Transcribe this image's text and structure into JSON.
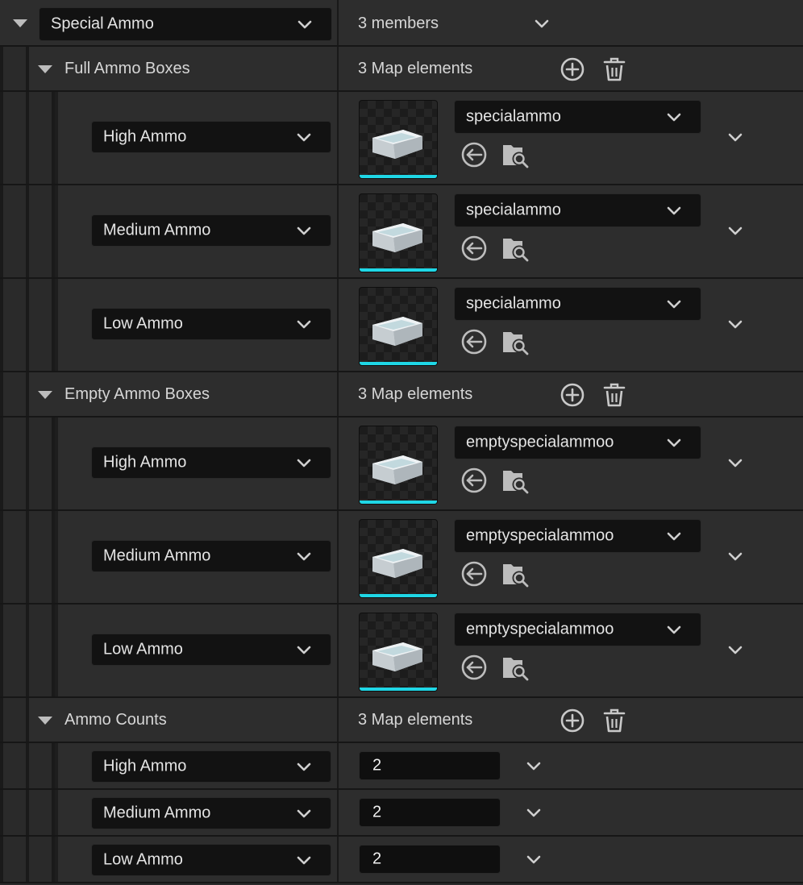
{
  "accent_color": "#1fd7e6",
  "top": {
    "category_value": "Special Ammo",
    "summary": "3 members"
  },
  "maps": [
    {
      "title": "Full Ammo Boxes",
      "count_label": "3 Map elements",
      "entries": [
        {
          "key": "High Ammo",
          "asset": "specialammo"
        },
        {
          "key": "Medium Ammo",
          "asset": "specialammo"
        },
        {
          "key": "Low Ammo",
          "asset": "specialammo"
        }
      ]
    },
    {
      "title": "Empty Ammo Boxes",
      "count_label": "3 Map elements",
      "entries": [
        {
          "key": "High Ammo",
          "asset": "emptyspecialammoo"
        },
        {
          "key": "Medium Ammo",
          "asset": "emptyspecialammoo"
        },
        {
          "key": "Low Ammo",
          "asset": "emptyspecialammoo"
        }
      ]
    },
    {
      "title": "Ammo Counts",
      "count_label": "3 Map elements",
      "entries": [
        {
          "key": "High Ammo",
          "value": "2"
        },
        {
          "key": "Medium Ammo",
          "value": "2"
        },
        {
          "key": "Low Ammo",
          "value": "2"
        }
      ]
    }
  ],
  "icons": {
    "expand": "triangle-down-icon",
    "dropdown": "chevron-down-icon",
    "add": "plus-circle-icon",
    "delete": "trash-icon",
    "use_selected": "arrow-left-circle-icon",
    "browse": "folder-search-icon",
    "thumbnail": "ammo-box-thumbnail"
  }
}
